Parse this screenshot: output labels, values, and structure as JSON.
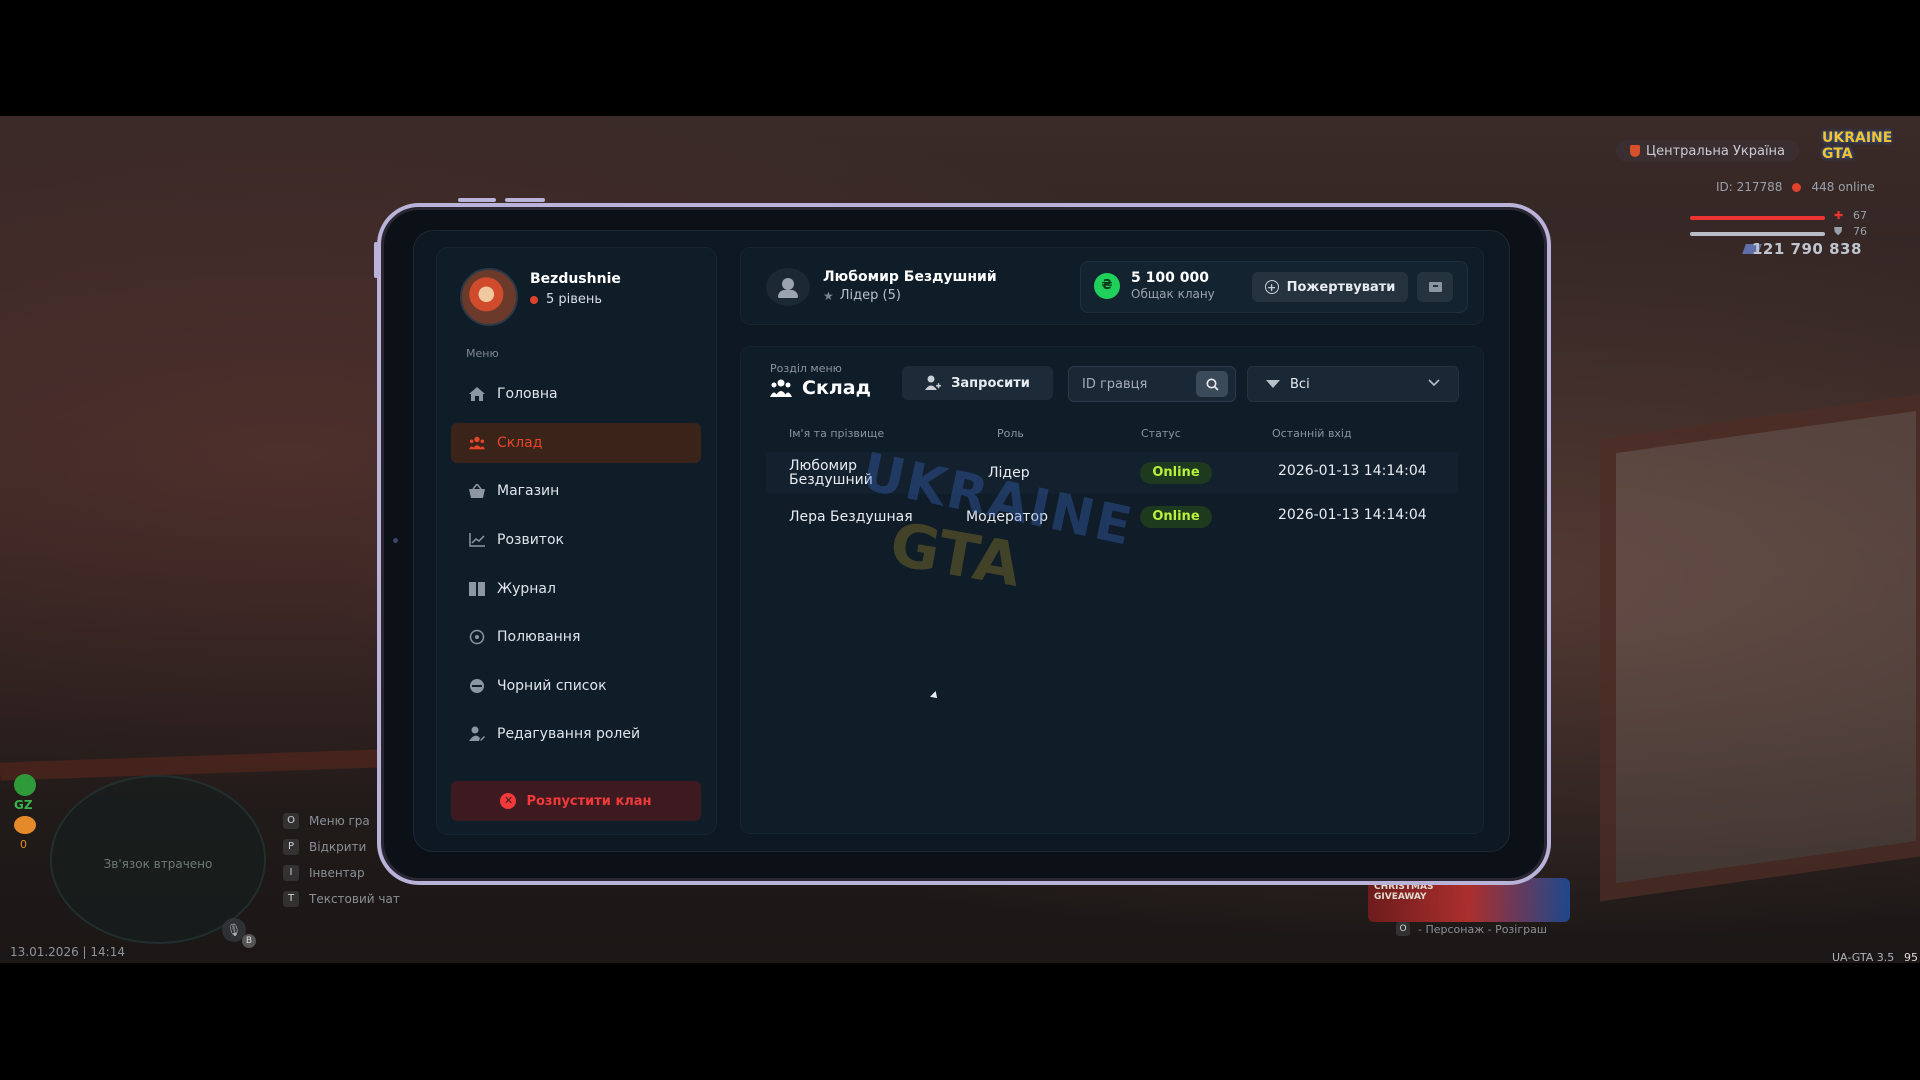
{
  "hud": {
    "server": "Центральна Україна",
    "logo": "UKRAINE GTA",
    "player_id": "ID: 217788",
    "online": "448 online",
    "health": "67",
    "armor": "76",
    "money": "121 790 838",
    "connection_lost": "Зв'язок втрачено",
    "gz_label": "GZ",
    "gz_count": "0",
    "mic_key": "B",
    "datetime": "13.01.2026 | 14:14",
    "version": "UA-GTA 3.5",
    "fps": "95",
    "key_hints": [
      {
        "key": "O",
        "label": "Меню гра"
      },
      {
        "key": "P",
        "label": "Відкрити"
      },
      {
        "key": "I",
        "label": "Інвентар"
      },
      {
        "key": "T",
        "label": "Текстовий чат"
      }
    ],
    "event_banner": "CHRISTMAS GIVEAWAY",
    "event_hint_key": "O",
    "event_hint": "- Персонаж - Розіграш"
  },
  "tablet": {
    "profile": {
      "name": "Bezdushnie",
      "level": "5 рівень"
    },
    "menu_title": "Меню",
    "menu": [
      {
        "label": "Головна",
        "icon": "home-icon"
      },
      {
        "label": "Склад",
        "icon": "people-icon",
        "active": true
      },
      {
        "label": "Магазин",
        "icon": "basket-icon"
      },
      {
        "label": "Розвиток",
        "icon": "chart-icon"
      },
      {
        "label": "Журнал",
        "icon": "book-icon"
      },
      {
        "label": "Полювання",
        "icon": "target-icon"
      },
      {
        "label": "Чорний список",
        "icon": "block-icon"
      },
      {
        "label": "Редагування ролей",
        "icon": "user-edit-icon"
      }
    ],
    "disband_label": "Розпустити клан",
    "header": {
      "leader_name": "Любомир Бездушний",
      "leader_role": "Лідер (5)",
      "bank_amount": "5 100 000",
      "bank_label": "Общак клану",
      "coin_symbol": "₴",
      "donate_label": "Пожертвувати"
    },
    "section": {
      "subtitle": "Розділ меню",
      "title": "Склад",
      "invite_label": "Запросити",
      "search_placeholder": "ID гравця",
      "filter_value": "Всі"
    },
    "table": {
      "headers": [
        "Ім'я та прізвище",
        "Роль",
        "Статус",
        "Останній вхід"
      ],
      "rows": [
        {
          "name": "Любомир Бездушний",
          "role": "Лідер",
          "status": "Online",
          "last_login": "2026-01-13 14:14:04"
        },
        {
          "name": "Лера Бездушная",
          "role": "Модератор",
          "status": "Online",
          "last_login": "2026-01-13 14:14:04"
        }
      ]
    },
    "watermark_1": "UKRAINE",
    "watermark_2": "GTA"
  },
  "colors": {
    "accent": "#e8462a",
    "online": "#b9f23a",
    "coin": "#1fd15a",
    "tablet_frame": "#b9b3d9"
  }
}
